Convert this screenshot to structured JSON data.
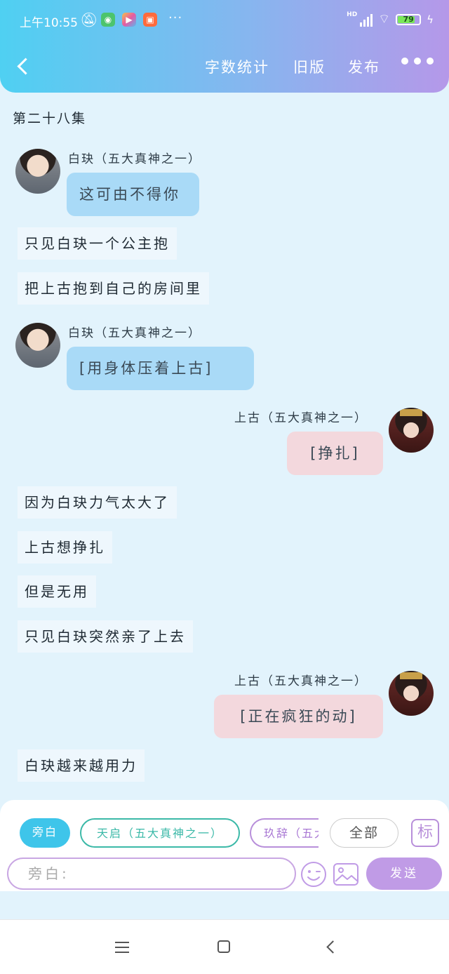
{
  "status_bar": {
    "time": "上午10:55",
    "icons": [
      "bell-off-icon",
      "android-app-icon",
      "game-app-icon",
      "video-app-icon"
    ],
    "more": "···",
    "network": "HD",
    "battery": "79"
  },
  "header": {
    "back_icon": "chevron-left-icon",
    "word_count": "字数统计",
    "old_version": "旧版",
    "publish": "发布",
    "more_icon": "more-dots-icon"
  },
  "episode_title": "第二十八集",
  "messages": [
    {
      "type": "dialog",
      "side": "left",
      "speaker": "白玦（五大真神之一）",
      "text": "这可由不得你"
    },
    {
      "type": "narration",
      "text": "只见白玦一个公主抱"
    },
    {
      "type": "narration",
      "text": "把上古抱到自己的房间里"
    },
    {
      "type": "dialog",
      "side": "left",
      "speaker": "白玦（五大真神之一）",
      "text": "[用身体压着上古]"
    },
    {
      "type": "dialog",
      "side": "right",
      "speaker": "上古（五大真神之一）",
      "text": "[挣扎]"
    },
    {
      "type": "narration",
      "text": "因为白玦力气太大了"
    },
    {
      "type": "narration",
      "text": "上古想挣扎"
    },
    {
      "type": "narration",
      "text": "但是无用"
    },
    {
      "type": "narration",
      "text": "只见白玦突然亲了上去"
    },
    {
      "type": "dialog",
      "side": "right",
      "speaker": "上古（五大真神之一）",
      "text": "[正在疯狂的动]"
    },
    {
      "type": "narration",
      "text": "白玦越来越用力"
    }
  ],
  "composer": {
    "roles": [
      "旁白",
      "天启（五大真神之一）",
      "玖辞（五大"
    ],
    "all_label": "全部",
    "tag_label": "标",
    "input_text": "旁白:",
    "send_label": "发送",
    "emoji_icon": "smile-wink-icon",
    "image_icon": "image-icon"
  },
  "system_nav": {
    "icons": [
      "menu-icon",
      "home-icon",
      "back-icon"
    ]
  },
  "colors": {
    "accent_cyan": "#3ec5ea",
    "accent_purple": "#c09be6",
    "bubble_blue": "#a9daf7",
    "bubble_pink": "#f3d8dd",
    "background": "#e2f3fc"
  }
}
